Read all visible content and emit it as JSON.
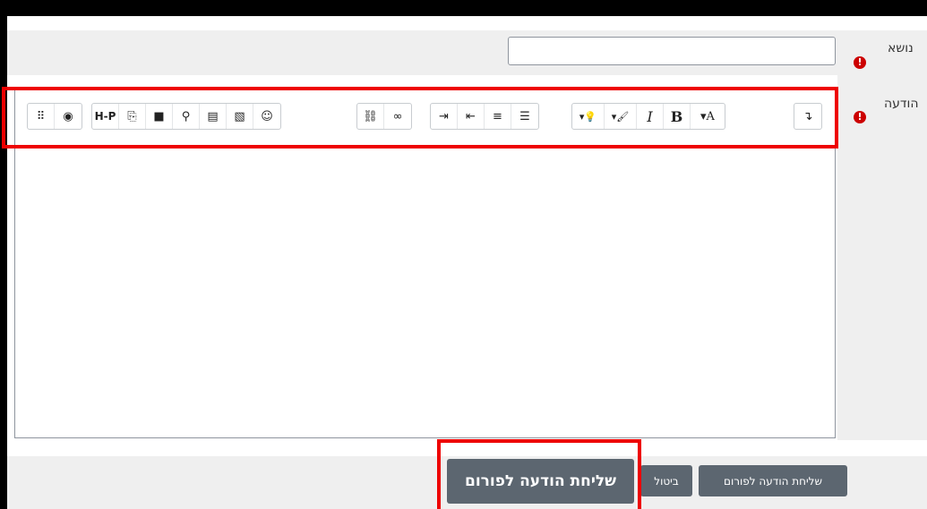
{
  "form": {
    "subject_label": "נושא",
    "message_label": "הודעה",
    "required_mark": "!",
    "subject_value": ""
  },
  "toolbar": {
    "groups": [
      [
        "braille-icon",
        "accessibility-icon"
      ],
      [
        "H-P",
        "copy-icon",
        "video-icon",
        "mic-icon",
        "file-icon",
        "image-icon",
        "emoji-icon"
      ],
      [
        "unlink-icon",
        "link-icon"
      ],
      [
        "indent-icon",
        "outdent-icon",
        "ordered-list-icon",
        "bullet-list-icon"
      ],
      [
        "▾💡",
        "▾🖌",
        "I",
        "B",
        "▾A"
      ],
      [
        "↴"
      ]
    ],
    "labels": {
      "h5p": "H-P",
      "italic": "I",
      "bold": "B",
      "font": "▾A",
      "highlight": "▾💡",
      "brush": "▾🖌",
      "collapse": "↴"
    }
  },
  "buttons": {
    "post_big": "שליחת הודעה לפורום",
    "cancel": "ביטול",
    "post": "שליחת הודעה לפורום"
  }
}
